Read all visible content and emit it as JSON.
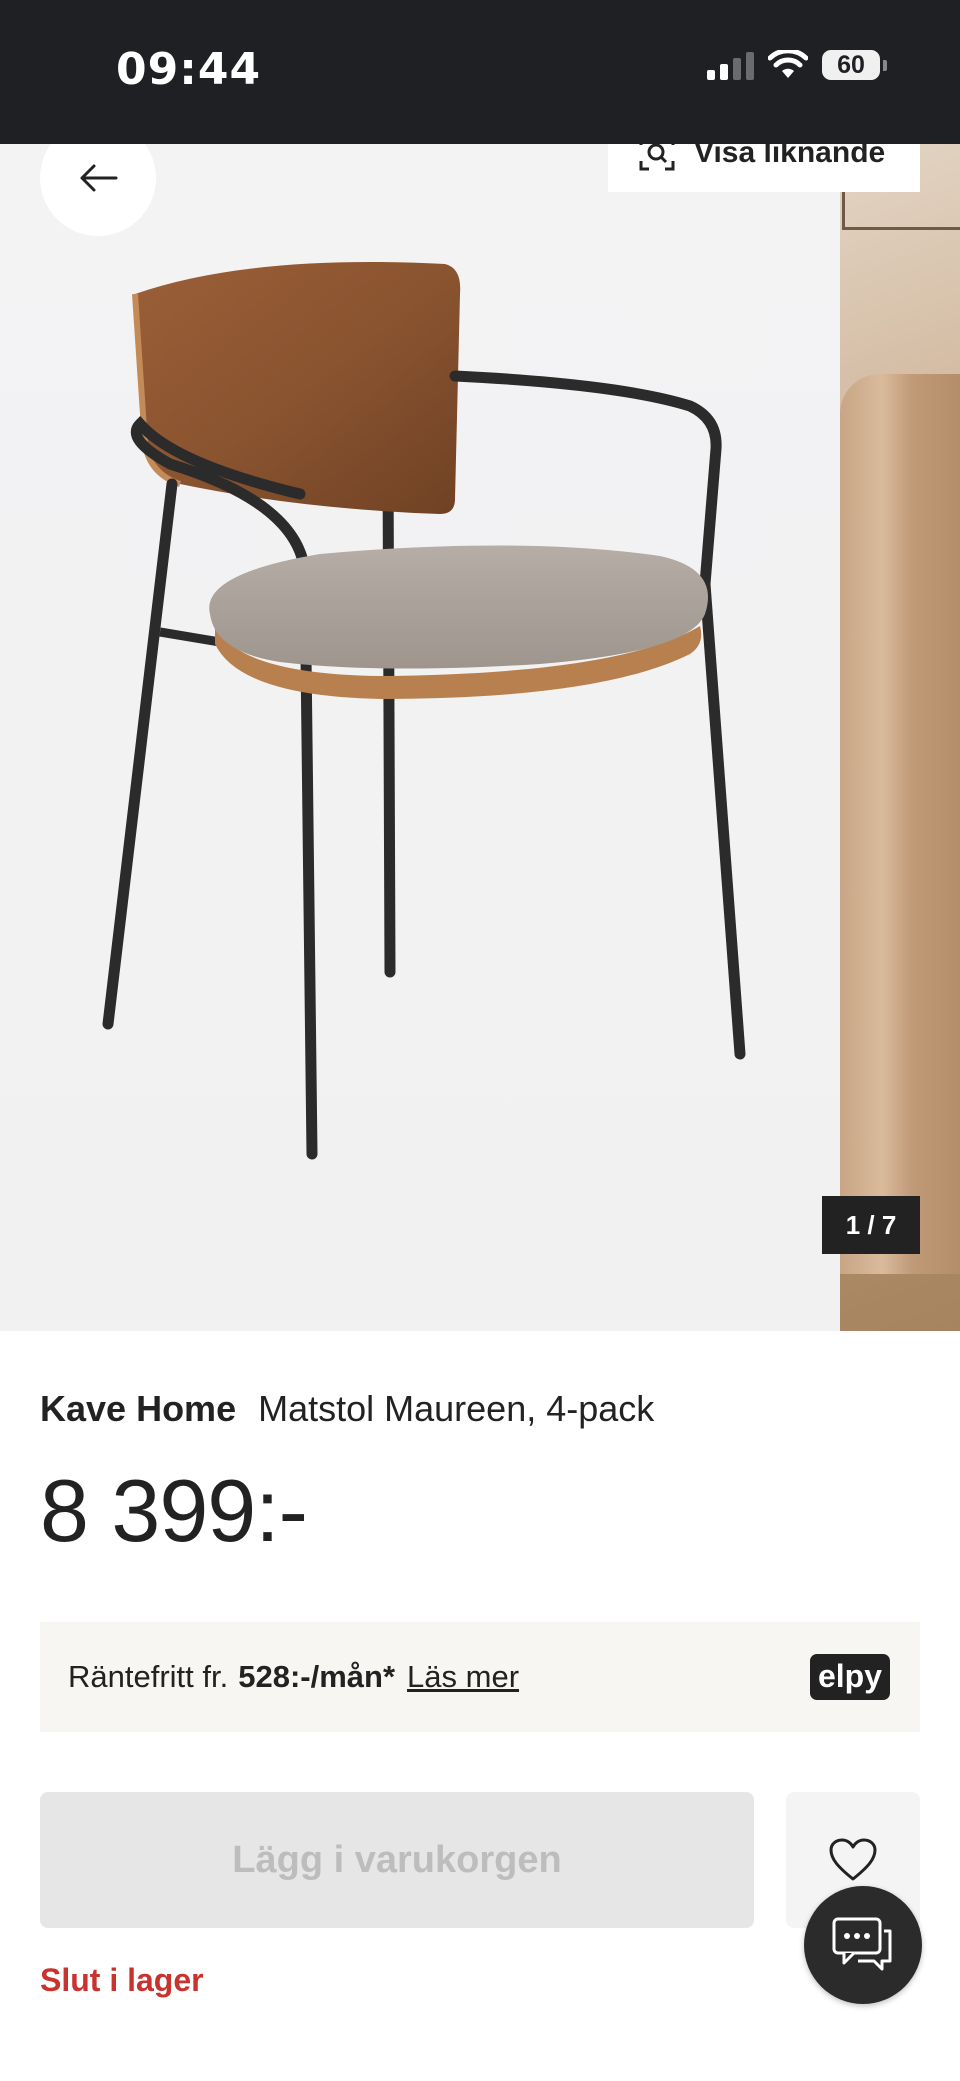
{
  "status_bar": {
    "time": "09:44",
    "battery": "60"
  },
  "gallery": {
    "similar_label": "Visa liknande",
    "counter": "1 / 7"
  },
  "product": {
    "brand": "Kave Home",
    "name": "Matstol Maureen, 4-pack",
    "price": "8 399:-"
  },
  "financing": {
    "prefix": "Räntefritt fr.",
    "amount": "528:-/mån*",
    "link": "Läs mer",
    "provider": "elpy"
  },
  "actions": {
    "add_to_cart": "Lägg i varukorgen",
    "stock_status": "Slut i lager"
  },
  "colors": {
    "accent_red": "#c8332e",
    "dark": "#222222",
    "disabled_bg": "#e6e6e6"
  }
}
